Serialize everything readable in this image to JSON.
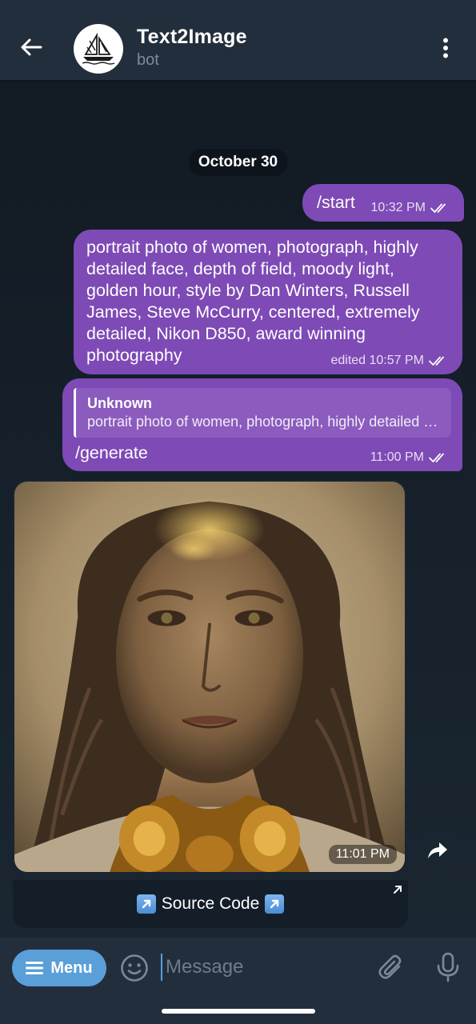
{
  "header": {
    "title": "Text2Image",
    "subtitle": "bot"
  },
  "chat": {
    "date_label": "October 30",
    "messages": [
      {
        "direction": "outgoing",
        "text": "/start",
        "time": "10:32 PM",
        "status": "read"
      },
      {
        "direction": "outgoing",
        "text": "portrait photo of women, photograph, highly detailed face, depth of field, moody light, golden hour, style by Dan Winters, Russell James, Steve McCurry, centered, extremely detailed, Nikon D850, award winning photography",
        "time": "edited 10:57 PM",
        "status": "read"
      },
      {
        "direction": "outgoing",
        "reply_name": "Unknown",
        "reply_text": "portrait photo of women, photograph, highly detailed face, depth of field, moody light, golden hour",
        "text": "/generate",
        "time": "11:00 PM",
        "status": "read"
      },
      {
        "direction": "incoming",
        "type": "photo",
        "time": "11:01 PM",
        "button_label": "Source Code"
      }
    ]
  },
  "composer": {
    "menu_label": "Menu",
    "placeholder": "Message"
  },
  "colors": {
    "outgoing_bubble": "#7e4ab6",
    "header_bg": "#232e3c",
    "chat_bg": "#17212b",
    "menu_button": "#5a9fd8"
  },
  "icons": {
    "back": "arrow-left-icon",
    "more": "more-vertical-icon",
    "read": "double-check-icon",
    "share": "share-arrow-icon",
    "link": "external-link-icon",
    "emoji": "smiley-icon",
    "attach": "paperclip-icon",
    "mic": "microphone-icon"
  }
}
